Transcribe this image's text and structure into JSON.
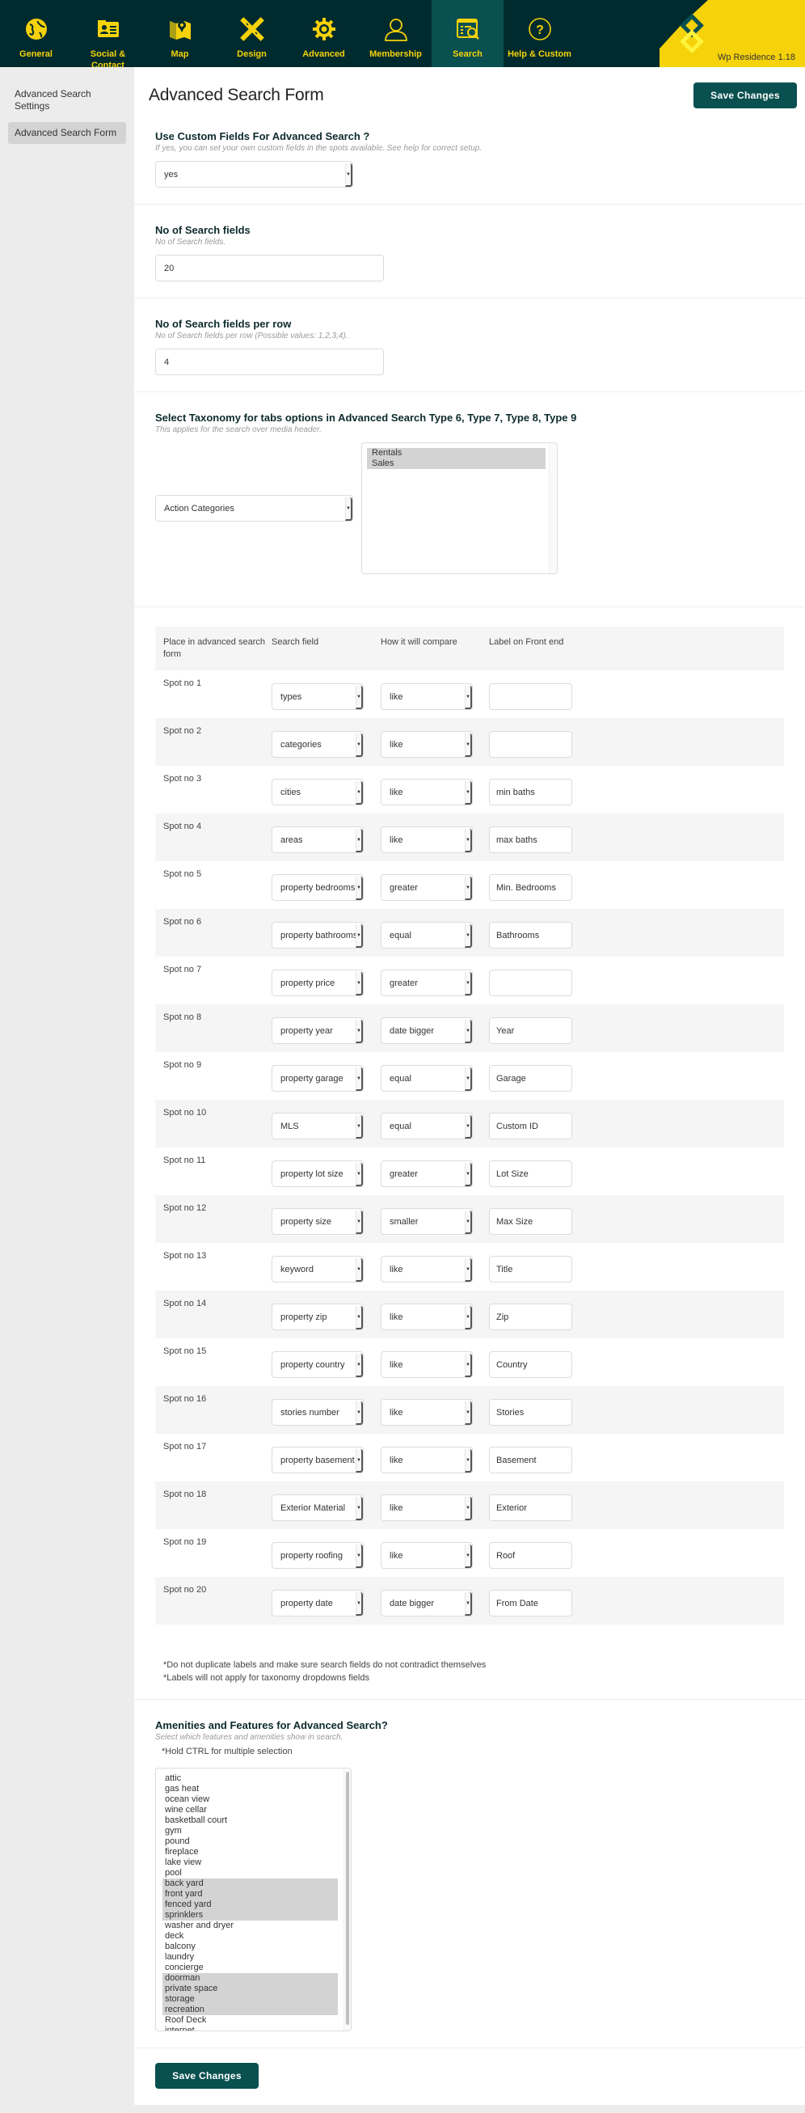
{
  "topnav": {
    "items": [
      {
        "label": "General",
        "icon": "globe-icon",
        "active": false
      },
      {
        "label": "Social & Contact",
        "icon": "contact-card-icon",
        "active": false
      },
      {
        "label": "Map",
        "icon": "map-pin-icon",
        "active": false
      },
      {
        "label": "Design",
        "icon": "pencil-ruler-icon",
        "active": false
      },
      {
        "label": "Advanced",
        "icon": "gear-icon",
        "active": false
      },
      {
        "label": "Membership",
        "icon": "user-icon",
        "active": false
      },
      {
        "label": "Search",
        "icon": "search-list-icon",
        "active": true
      },
      {
        "label": "Help & Custom",
        "icon": "question-circle-icon",
        "active": false
      }
    ],
    "version": "Wp Residence 1.18",
    "colors": {
      "bar": "#002b2e",
      "accent": "#f5d20a",
      "active_tab": "#0a5050"
    }
  },
  "sidebar": {
    "items": [
      {
        "label": "Advanced Search Settings",
        "active": false
      },
      {
        "label": "Advanced Search Form",
        "active": true
      }
    ]
  },
  "header": {
    "title": "Advanced Search Form",
    "save_label": "Save Changes"
  },
  "custom_fields": {
    "title": "Use Custom Fields For Advanced Search ?",
    "help": "If yes, you can set your own custom fields in the spots available. See help for correct setup.",
    "value": "yes"
  },
  "num_fields": {
    "title": "No of Search fields",
    "help": "No of Search fields.",
    "value": "20"
  },
  "fields_per_row": {
    "title": "No of Search fields per row",
    "help": "No of Search fields per row (Possible values: 1,2,3,4).",
    "value": "4"
  },
  "taxonomy": {
    "title": "Select Taxonomy for tabs options in Advanced Search Type 6, Type 7, Type 8, Type 9",
    "help": "This applies for the search over media header.",
    "value": "Action Categories",
    "options": [
      {
        "label": "Rentals",
        "selected": true
      },
      {
        "label": "Sales",
        "selected": true
      }
    ]
  },
  "table": {
    "headers": [
      "Place in advanced search form",
      "Search field",
      "How it will compare",
      "Label on Front end"
    ],
    "rows": [
      {
        "spot": "Spot no 1",
        "field": "types",
        "compare": "like",
        "label": ""
      },
      {
        "spot": "Spot no 2",
        "field": "categories",
        "compare": "like",
        "label": ""
      },
      {
        "spot": "Spot no 3",
        "field": "cities",
        "compare": "like",
        "label": "min baths"
      },
      {
        "spot": "Spot no 4",
        "field": "areas",
        "compare": "like",
        "label": "max baths"
      },
      {
        "spot": "Spot no 5",
        "field": "property bedrooms",
        "compare": "greater",
        "label": "Min. Bedrooms"
      },
      {
        "spot": "Spot no 6",
        "field": "property bathrooms",
        "compare": "equal",
        "label": "Bathrooms"
      },
      {
        "spot": "Spot no 7",
        "field": "property price",
        "compare": "greater",
        "label": ""
      },
      {
        "spot": "Spot no 8",
        "field": "property year",
        "compare": "date bigger",
        "label": "Year"
      },
      {
        "spot": "Spot no 9",
        "field": "property garage",
        "compare": "equal",
        "label": "Garage"
      },
      {
        "spot": "Spot no 10",
        "field": "MLS",
        "compare": "equal",
        "label": "Custom ID"
      },
      {
        "spot": "Spot no 11",
        "field": "property lot size",
        "compare": "greater",
        "label": "Lot Size"
      },
      {
        "spot": "Spot no 12",
        "field": "property size",
        "compare": "smaller",
        "label": "Max Size"
      },
      {
        "spot": "Spot no 13",
        "field": "keyword",
        "compare": "like",
        "label": "Title"
      },
      {
        "spot": "Spot no 14",
        "field": "property zip",
        "compare": "like",
        "label": "Zip"
      },
      {
        "spot": "Spot no 15",
        "field": "property country",
        "compare": "like",
        "label": "Country"
      },
      {
        "spot": "Spot no 16",
        "field": "stories number",
        "compare": "like",
        "label": "Stories"
      },
      {
        "spot": "Spot no 17",
        "field": "property basement",
        "compare": "like",
        "label": "Basement"
      },
      {
        "spot": "Spot no 18",
        "field": "Exterior Material",
        "compare": "like",
        "label": "Exterior"
      },
      {
        "spot": "Spot no 19",
        "field": "property roofing",
        "compare": "like",
        "label": "Roof"
      },
      {
        "spot": "Spot no 20",
        "field": "property date",
        "compare": "date bigger",
        "label": "From Date"
      }
    ]
  },
  "notes": [
    "*Do not duplicate labels and make sure search fields do not contradict themselves",
    "*Labels will not apply for taxonomy dropdowns fields"
  ],
  "amenities": {
    "title": "Amenities and Features for Advanced Search?",
    "help": "Select which features and amenities show in search.",
    "note": "*Hold CTRL for multiple selection",
    "options": [
      {
        "label": "attic",
        "selected": false
      },
      {
        "label": "gas heat",
        "selected": false
      },
      {
        "label": "ocean view",
        "selected": false
      },
      {
        "label": "wine cellar",
        "selected": false
      },
      {
        "label": "basketball court",
        "selected": false
      },
      {
        "label": "gym",
        "selected": false
      },
      {
        "label": "pound",
        "selected": false
      },
      {
        "label": "fireplace",
        "selected": false
      },
      {
        "label": "lake view",
        "selected": false
      },
      {
        "label": "pool",
        "selected": false
      },
      {
        "label": "back yard",
        "selected": true
      },
      {
        "label": "front yard",
        "selected": true
      },
      {
        "label": "fenced yard",
        "selected": true
      },
      {
        "label": "sprinklers",
        "selected": true
      },
      {
        "label": "washer and dryer",
        "selected": false
      },
      {
        "label": "deck",
        "selected": false
      },
      {
        "label": "balcony",
        "selected": false
      },
      {
        "label": "laundry",
        "selected": false
      },
      {
        "label": "concierge",
        "selected": false
      },
      {
        "label": "doorman",
        "selected": true
      },
      {
        "label": "private space",
        "selected": true
      },
      {
        "label": "storage",
        "selected": true
      },
      {
        "label": "recreation",
        "selected": true
      },
      {
        "label": "Roof Deck",
        "selected": false
      },
      {
        "label": "internet",
        "selected": false
      }
    ]
  },
  "footer": {
    "save_label": "Save Changes"
  }
}
